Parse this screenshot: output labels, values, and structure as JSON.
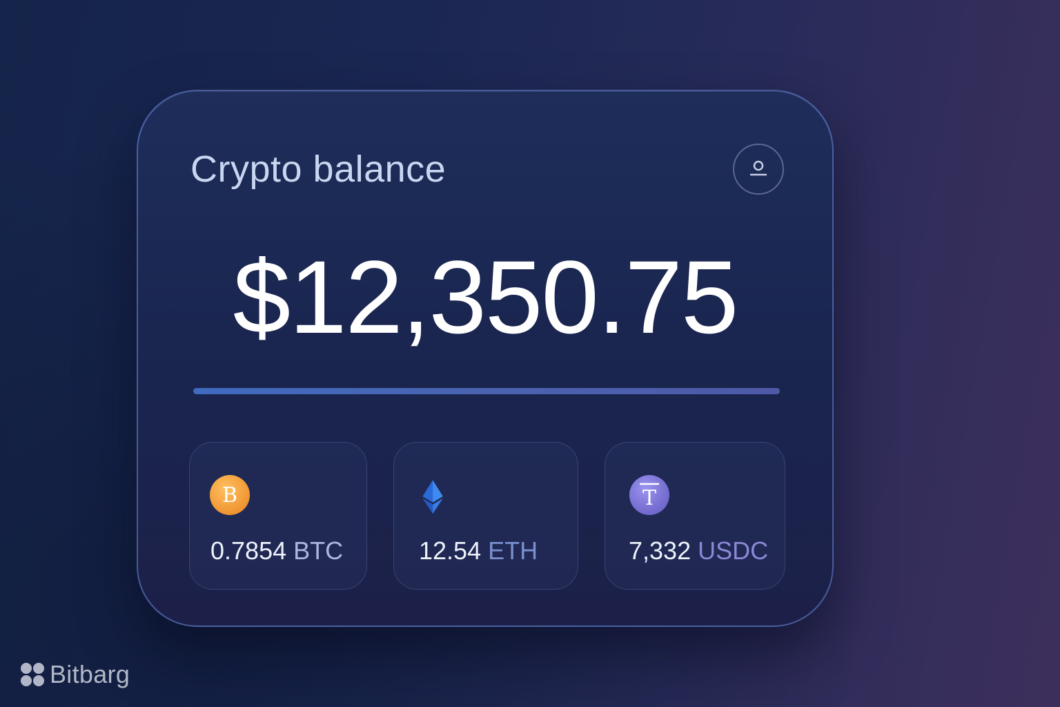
{
  "card": {
    "title": "Crypto balance",
    "total_balance": "$12,350.75"
  },
  "profile_button": {
    "icon": "user-icon"
  },
  "assets": [
    {
      "amount": "0.7854",
      "ticker": "BTC",
      "icon": "bitcoin-icon",
      "icon_glyph": "B",
      "color": "#f4a23e"
    },
    {
      "amount": "12.54",
      "ticker": "ETH",
      "icon": "ethereum-icon",
      "color": "#3f7ee8"
    },
    {
      "amount": "7,332",
      "ticker": "USDC",
      "icon": "tether-icon",
      "icon_glyph": "T",
      "color": "#7f78d8"
    }
  ],
  "brand": {
    "name": "Bitbarg"
  },
  "colors": {
    "background_start": "#15244a",
    "background_end": "#3d2f5c",
    "accent_divider": "#3f6bc0"
  }
}
